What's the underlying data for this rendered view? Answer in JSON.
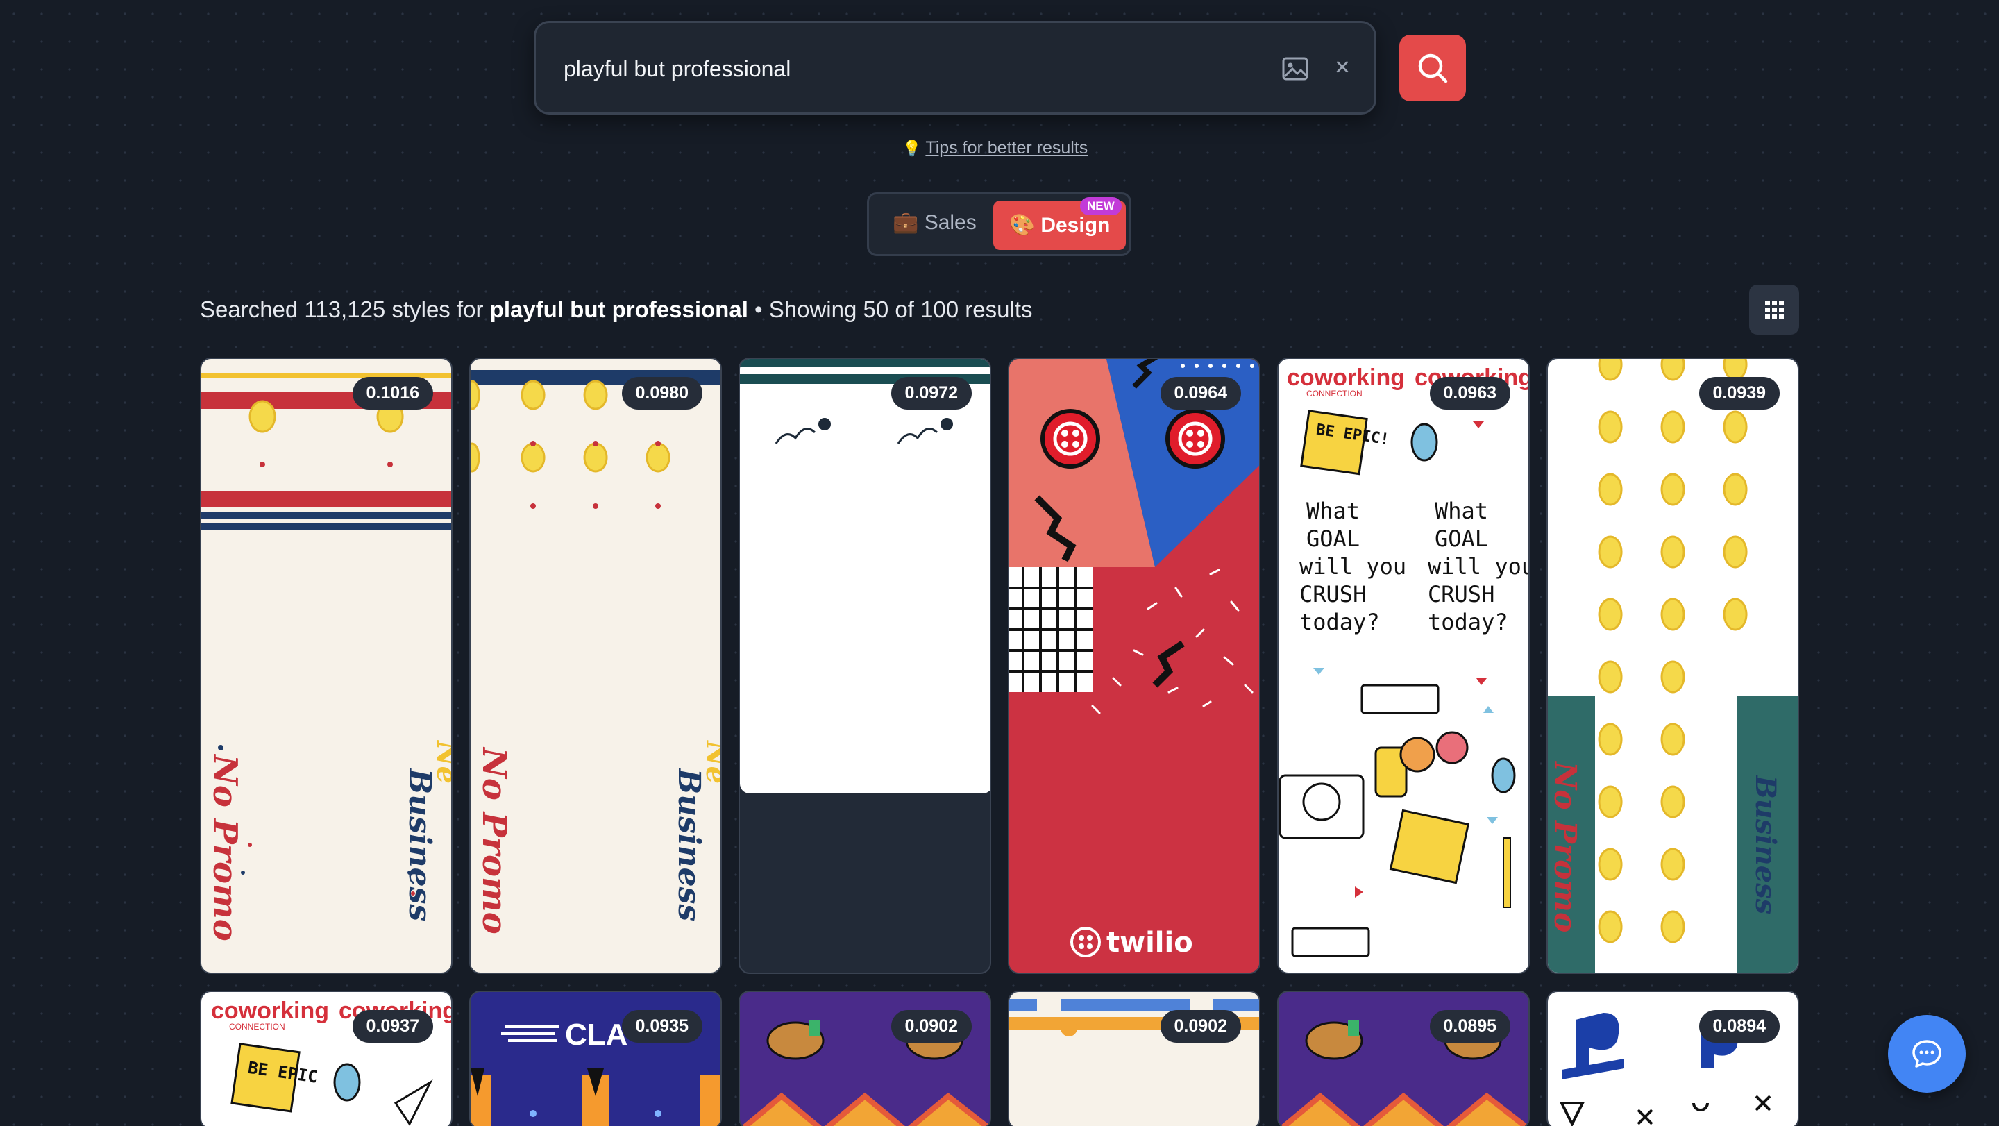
{
  "search": {
    "value": "playful but professional",
    "image_icon": "image-icon",
    "clear_label": "×",
    "submit_icon": "search-icon"
  },
  "tips": {
    "label": "Tips for better results",
    "icon": "lightbulb-icon"
  },
  "mode_toggle": {
    "sales_label": "💼 Sales",
    "design_label": "🎨 Design",
    "new_badge": "NEW",
    "active": "Design"
  },
  "summary": {
    "prefix": "Searched 113,125 styles for",
    "query": "playful but professional",
    "suffix": "• Showing 50 of 100 results"
  },
  "results": [
    {
      "score": "0.1016"
    },
    {
      "score": "0.0980"
    },
    {
      "score": "0.0972"
    },
    {
      "score": "0.0964",
      "brand_text": "twilio"
    },
    {
      "score": "0.0963",
      "texts": [
        "coworking",
        "CONNECTION",
        "BE EPIC!",
        "What",
        "GOAL",
        "will you",
        "CRUSH",
        "today?"
      ]
    },
    {
      "score": "0.0939"
    },
    {
      "score": "0.0937",
      "texts": [
        "coworking",
        "CONNECTION",
        "BE EPIC"
      ]
    },
    {
      "score": "0.0935",
      "brand_text": "CLA"
    },
    {
      "score": "0.0902"
    },
    {
      "score": "0.0902"
    },
    {
      "score": "0.0895"
    },
    {
      "score": "0.0894"
    }
  ],
  "colors": {
    "accent": "#e44a4a",
    "background": "#161c26",
    "new_badge": "#c23bd8",
    "chat": "#4285f4"
  },
  "chat_icon": "chat-bubble-icon",
  "view_toggle_icon": "grid-icon"
}
